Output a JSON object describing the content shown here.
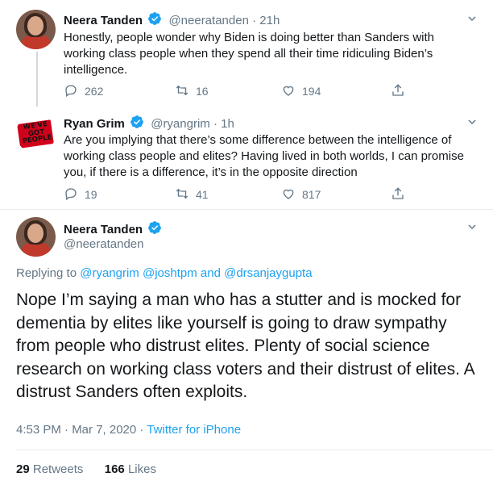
{
  "tweets": [
    {
      "name": "Neera Tanden",
      "handle": "@neeratanden",
      "time": "21h",
      "text": "Honestly, people wonder why Biden is doing better than Sanders with working class people when they spend all their time ridiculing Biden’s intelligence.",
      "replies": "262",
      "retweets": "16",
      "likes": "194"
    },
    {
      "name": "Ryan Grim",
      "handle": "@ryangrim",
      "time": "1h",
      "avatar_text": "WE'VE GOT PEOPLE",
      "text": "Are you implying that there’s some difference between the intelligence of working class people and elites? Having lived in both worlds, I can promise you, if there is a difference, it’s in the opposite direction",
      "replies": "19",
      "retweets": "41",
      "likes": "817"
    }
  ],
  "main": {
    "name": "Neera Tanden",
    "handle": "@neeratanden",
    "replying_prefix": "Replying to",
    "reply_user1": "@ryangrim",
    "reply_user2": "@joshtpm",
    "reply_and": "and",
    "reply_user3": "@drsanjaygupta",
    "text": "Nope I’m saying a man who has a stutter and is mocked for dementia by elites like yourself is going to draw sympathy from people who distrust elites. Plenty of social science research on working class voters and their distrust of elites. A distrust Sanders often exploits.",
    "timestamp": "4:53 PM · Mar 7, 2020",
    "source_sep": "·",
    "source": "Twitter for iPhone",
    "retweets_count": "29",
    "retweets_label": "Retweets",
    "likes_count": "166",
    "likes_label": "Likes"
  },
  "colors": {
    "accent": "#1da1f2",
    "muted": "#657786",
    "text": "#14171a",
    "verified": "#1da1f2"
  }
}
